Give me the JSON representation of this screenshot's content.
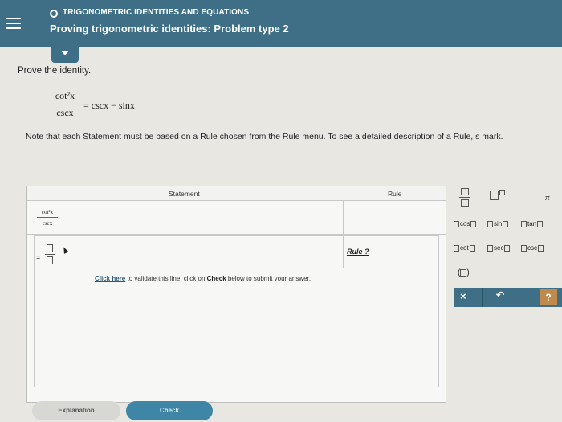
{
  "header": {
    "topic": "TRIGONOMETRIC IDENTITIES AND EQUATIONS",
    "title": "Proving trigonometric identities: Problem type 2"
  },
  "prompt": {
    "instruction": "Prove the identity.",
    "identity": {
      "numerator": "cot²x",
      "denominator": "cscx",
      "rhs": "= cscx − sinx"
    },
    "note": "Note that each Statement must be based on a Rule chosen from the Rule menu. To see a detailed description of a Rule, s mark."
  },
  "table": {
    "headers": {
      "statement": "Statement",
      "rule": "Rule"
    },
    "row1": {
      "numerator": "cot²x",
      "denominator": "cscx"
    },
    "row2": {
      "eq_sign": "=",
      "rule_link": "Rule ?"
    },
    "validate": {
      "link": "Click here",
      "mid": " to validate this line; click on ",
      "bold": "Check",
      "end": " below to submit your answer."
    }
  },
  "toolbar": {
    "pi": "π",
    "fn_row1": [
      "cos",
      "sin",
      "tan"
    ],
    "fn_row2": [
      "cot",
      "sec",
      "csc"
    ],
    "paren": "(",
    "paren_close": ")",
    "actions": {
      "clear": "×",
      "undo": "↶",
      "help": "?"
    }
  },
  "footer": {
    "explanation": "Explanation",
    "check": "Check"
  },
  "colors": {
    "header_bg": "#3f6f86",
    "help_button": "#c08b4a"
  }
}
